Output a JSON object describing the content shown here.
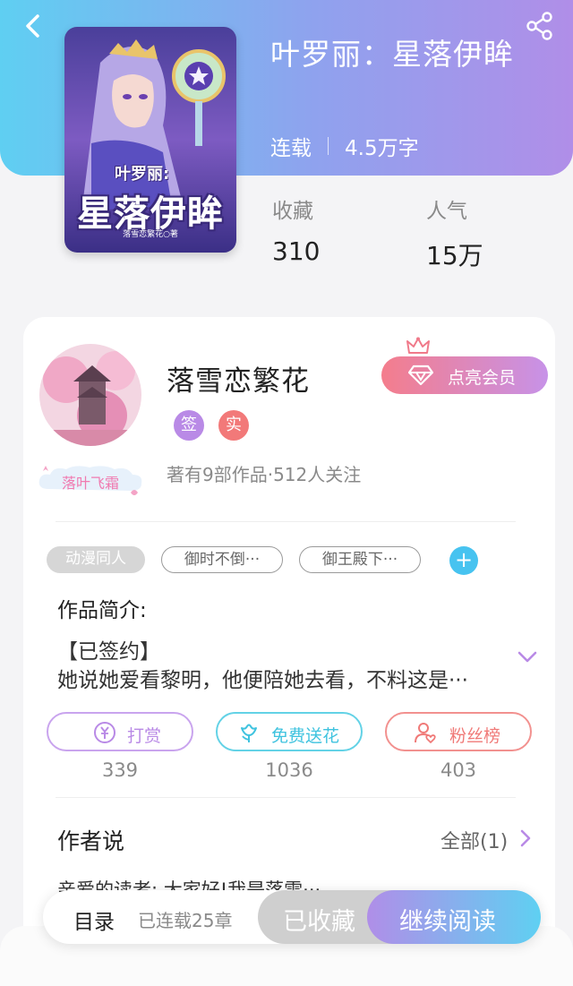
{
  "header": {
    "book_title": "叶罗丽：星落伊眸",
    "status": "连载",
    "word_count": "4.5万字",
    "colors": {
      "gradient_start": "#5fcff2",
      "gradient_end": "#b08ee8"
    }
  },
  "cover": {
    "subtitle": "叶罗丽:",
    "title": "星落伊眸",
    "author_line": "落雪恋繁花○著"
  },
  "stats": {
    "favorites_label": "收藏",
    "favorites_value": "310",
    "popularity_label": "人气",
    "popularity_value": "15万"
  },
  "author": {
    "name": "落雪恋繁花",
    "badge_signed": "签",
    "badge_verified": "实",
    "fan_tag": "落叶飞霜",
    "info": "著有9部作品·512人关注",
    "vip_label": "点亮会员"
  },
  "tags": {
    "category": "动漫同人",
    "tag1": "御时不倒···",
    "tag2": "御王殿下···",
    "add": "+"
  },
  "intro": {
    "heading": "作品简介:",
    "line1": "【已签约】",
    "line2": "她说她爱看黎明，他便陪她去看，不料这是···"
  },
  "actions": {
    "reward_label": "打赏",
    "reward_count": "339",
    "flower_label": "免费送花",
    "flower_count": "1036",
    "fans_label": "粉丝榜",
    "fans_count": "403"
  },
  "author_say": {
    "heading": "作者说",
    "all_label": "全部(1)",
    "preview": "亲爱的读者:      大家好!我是落雪···"
  },
  "bottom_bar": {
    "toc_label": "目录",
    "chapter_count": "已连载25章",
    "favorited_label": "已收藏",
    "read_label": "继续阅读"
  }
}
